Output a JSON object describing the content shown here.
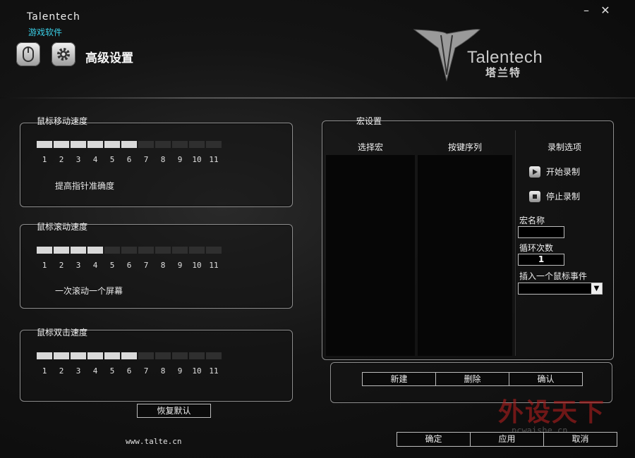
{
  "app": {
    "brand": "Talentech",
    "brand_sub": "游戏软件",
    "page_title": "高级设置"
  },
  "window": {
    "minimize": "–",
    "close": "✕"
  },
  "toolbar": {
    "mouse_icon": "mouse-icon",
    "settings_icon": "gear-icon"
  },
  "logo": {
    "text": "Talentech",
    "cn": "塔兰特"
  },
  "pointer_speed": {
    "title": "鼠标移动速度",
    "level": 6,
    "max": 11,
    "ticks": [
      "1",
      "2",
      "3",
      "4",
      "5",
      "6",
      "7",
      "8",
      "9",
      "10",
      "11"
    ],
    "desc": "提高指针准确度"
  },
  "scroll_speed": {
    "title": "鼠标滚动速度",
    "level": 4,
    "max": 11,
    "ticks": [
      "1",
      "2",
      "3",
      "4",
      "5",
      "6",
      "7",
      "8",
      "9",
      "10",
      "11"
    ],
    "desc": "一次滚动一个屏幕"
  },
  "double_click": {
    "title": "鼠标双击速度",
    "level": 6,
    "max": 11,
    "ticks": [
      "1",
      "2",
      "3",
      "4",
      "5",
      "6",
      "7",
      "8",
      "9",
      "10",
      "11"
    ]
  },
  "restore_default": "恢复默认",
  "macro": {
    "title": "宏设置",
    "col_select": "选择宏",
    "col_sequence": "按键序列",
    "col_options": "录制选项",
    "start_record": "开始录制",
    "stop_record": "停止录制",
    "name_label": "宏名称",
    "name_value": "",
    "loop_label": "循环次数",
    "loop_value": "1",
    "insert_label": "插入一个鼠标事件",
    "insert_value": "",
    "btn_new": "新建",
    "btn_delete": "删除",
    "btn_confirm": "确认"
  },
  "footer": {
    "url": "www.talte.cn",
    "ok": "确定",
    "apply": "应用",
    "cancel": "取消"
  },
  "watermark": {
    "text": "外设天下",
    "url": "pcwaishe.cn"
  },
  "colors": {
    "accent": "#3bd0e8",
    "seg_on": "#d9d9d9",
    "seg_off": "#2f2f2f"
  }
}
